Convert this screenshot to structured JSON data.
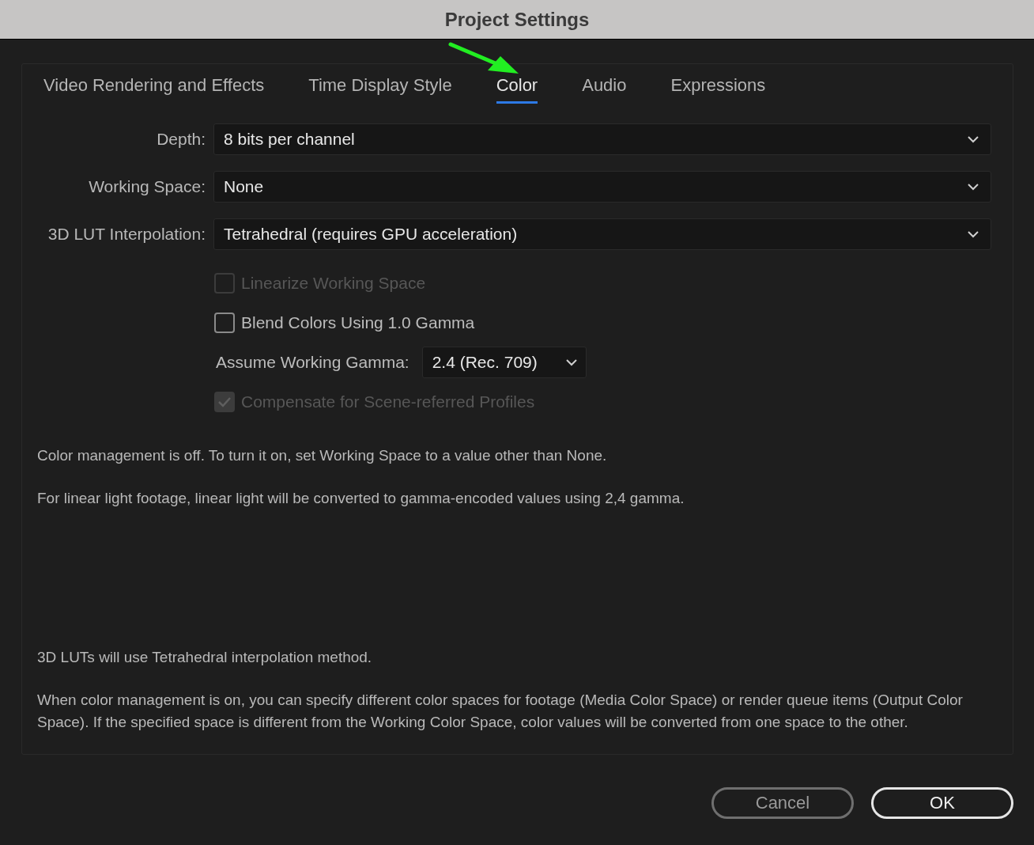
{
  "window": {
    "title": "Project Settings"
  },
  "tabs": [
    {
      "label": "Video Rendering and Effects",
      "selected": false
    },
    {
      "label": "Time Display Style",
      "selected": false
    },
    {
      "label": "Color",
      "selected": true
    },
    {
      "label": "Audio",
      "selected": false
    },
    {
      "label": "Expressions",
      "selected": false
    }
  ],
  "fields": [
    {
      "label": "Depth:",
      "value": "8 bits per channel"
    },
    {
      "label": "Working Space:",
      "value": "None"
    },
    {
      "label": "3D LUT Interpolation:",
      "value": "Tetrahedral (requires GPU acceleration)"
    }
  ],
  "options": [
    {
      "kind": "checkbox",
      "label": "Linearize Working Space",
      "checked": false,
      "disabled": true
    },
    {
      "kind": "checkbox",
      "label": "Blend Colors Using 1.0 Gamma",
      "checked": false,
      "disabled": false
    },
    {
      "kind": "select",
      "label": "Assume Working Gamma:",
      "value": "2.4 (Rec. 709)"
    },
    {
      "kind": "checkbox",
      "label": "Compensate for Scene-referred Profiles",
      "checked": true,
      "disabled": true
    }
  ],
  "notes_top": [
    "Color management is off. To turn it on, set Working Space to a value other than None.",
    "For linear light footage, linear light will be converted to gamma-encoded values using 2,4 gamma."
  ],
  "notes_bottom": [
    "3D LUTs will use Tetrahedral interpolation method.",
    "When color management is on, you can specify different color spaces for footage (Media Color Space) or render queue items (Output Color Space). If the specified space is different from the Working Color Space, color values will be converted from one space to the other."
  ],
  "buttons": [
    {
      "label": "Cancel",
      "kind": "secondary"
    },
    {
      "label": "OK",
      "kind": "primary"
    }
  ]
}
